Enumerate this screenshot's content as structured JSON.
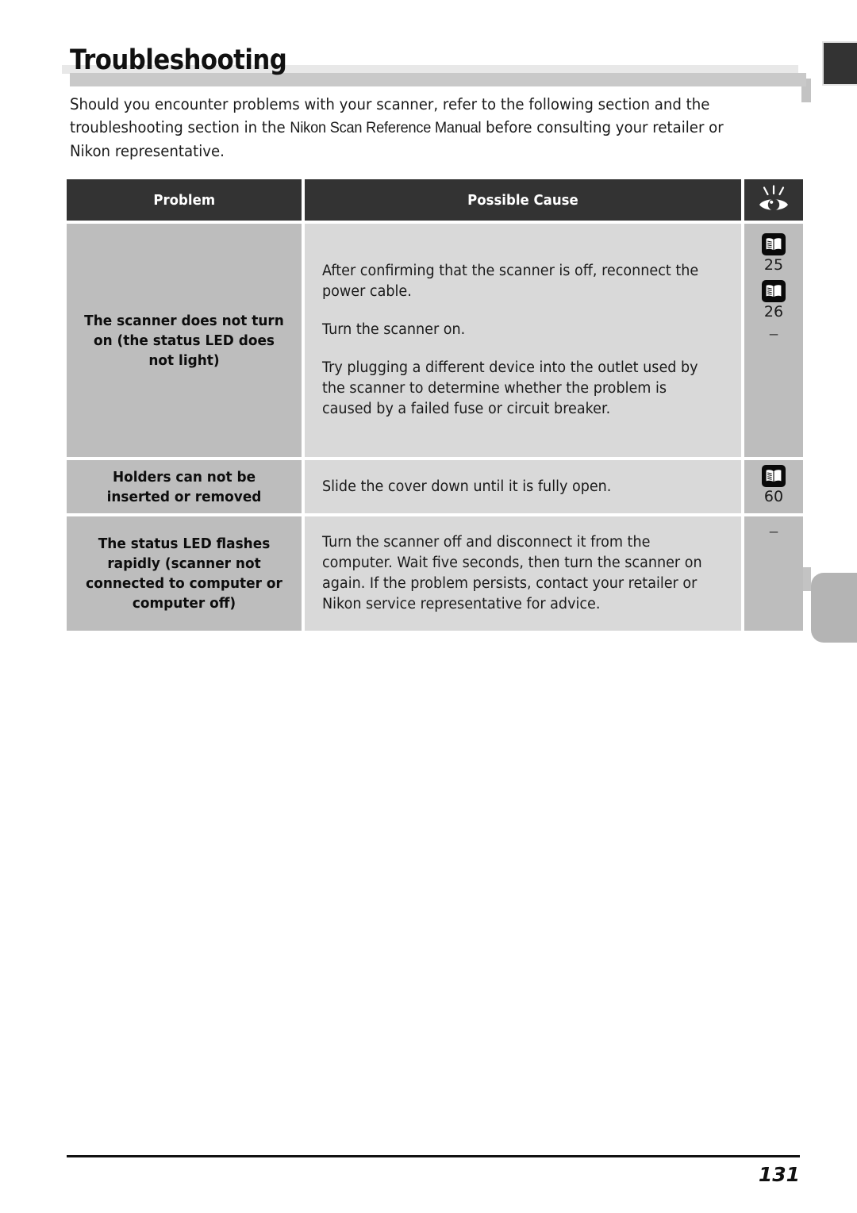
{
  "page": {
    "title": "Troubleshooting",
    "intro_before_italic": "Should you encounter problems with your scanner, refer to the following section and the troubleshooting section in the ",
    "intro_italic": "Nikon Scan Reference Manual",
    "intro_after_italic": " before consulting your retailer or Nikon representative.",
    "page_number": "131"
  },
  "colors": {
    "header_bg": "#333333",
    "problem_bg": "#bdbdbd",
    "cause_bg": "#d9d9d9",
    "ref_bg": "#bdbdbd",
    "text": "#1a1a1a",
    "band_light": "#e8e8e8",
    "band_dark": "#c9c9c9",
    "tab_dark": "#333333",
    "tab_gray": "#b4b4b4"
  },
  "table": {
    "headers": {
      "problem": "Problem",
      "cause": "Possible Cause",
      "reference_icon": "eye-icon"
    },
    "rows": [
      {
        "problem": "The scanner does not turn on (the status LED does not light)",
        "causes": [
          "After confirming that the scanner is off, reconnect the power cable.",
          "Turn the scanner on.",
          "Try plugging a different device into the outlet used by the scanner to determine whether the problem is caused by a failed fuse or circuit breaker."
        ],
        "references": [
          {
            "icon": "book-icon",
            "page": "25"
          },
          {
            "icon": "book-icon",
            "page": "26"
          },
          {
            "icon": "dash",
            "page": "–"
          }
        ]
      },
      {
        "problem": "Holders can not be inserted or removed",
        "causes": [
          "Slide the cover down until it is fully open."
        ],
        "references": [
          {
            "icon": "book-icon",
            "page": "60"
          }
        ]
      },
      {
        "problem": "The status LED flashes rapidly (scanner not connected to computer or computer off)",
        "causes": [
          "Turn the scanner off and disconnect it from the computer. Wait five seconds, then turn the scanner on again.  If the problem persists, contact your retailer or Nikon service representative for advice."
        ],
        "references": [
          {
            "icon": "dash",
            "page": "–"
          }
        ]
      }
    ]
  }
}
